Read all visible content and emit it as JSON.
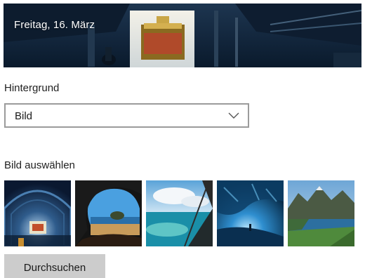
{
  "preview": {
    "date_text": "Freitag, 16. März"
  },
  "background": {
    "label": "Hintergrund",
    "selected": "Bild"
  },
  "picture_chooser": {
    "label": "Bild auswählen",
    "thumbnails": [
      {
        "icon": "tunnel-exhibit-thumbnail-icon"
      },
      {
        "icon": "cave-beach-thumbnail-icon"
      },
      {
        "icon": "coastal-lagoon-thumbnail-icon"
      },
      {
        "icon": "ice-cave-thumbnail-icon"
      },
      {
        "icon": "mountain-lake-thumbnail-icon"
      }
    ]
  },
  "browse_button": {
    "label": "Durchsuchen"
  }
}
